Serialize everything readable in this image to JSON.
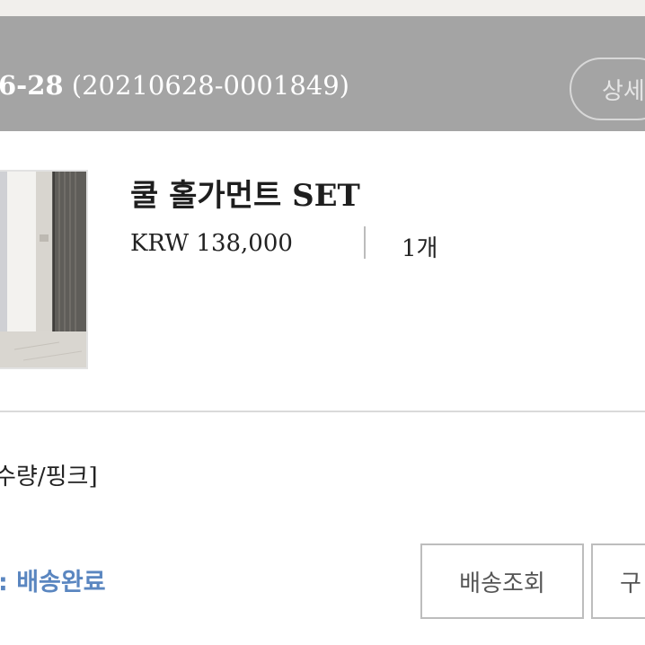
{
  "order": {
    "date": "6-28",
    "number": "(20210628-0001849)",
    "detail_label": "상세"
  },
  "product": {
    "name": "쿨 홀가먼트 SET",
    "price": "KRW 138,000",
    "quantity": "1개",
    "option": "수량/핑크]"
  },
  "status": {
    "text": ": 배송완료",
    "color": "#5a86c0"
  },
  "actions": {
    "track_label": "배송조회",
    "purchase_label": "구"
  },
  "colors": {
    "header_bg": "#a4a4a4",
    "page_bg": "#f1efec"
  }
}
